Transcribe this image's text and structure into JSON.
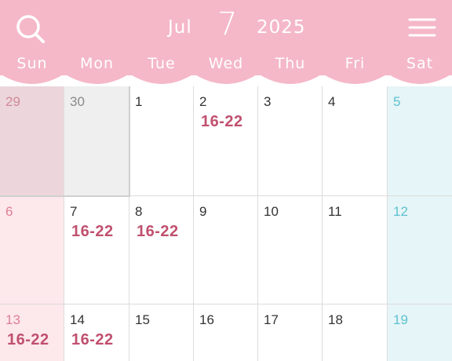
{
  "header": {
    "month_name": "Jul",
    "month_number": "7",
    "year": "2025",
    "search_icon": "search-icon",
    "menu_icon": "menu-icon",
    "text_color": "#ffffff",
    "background_color": "#f5b8c8"
  },
  "weekdays": [
    "Sun",
    "Mon",
    "Tue",
    "Wed",
    "Thu",
    "Fri",
    "Sat"
  ],
  "weeks": [
    [
      {
        "day": "29",
        "event": "",
        "prev": true
      },
      {
        "day": "30",
        "event": "",
        "prev": true
      },
      {
        "day": "1",
        "event": ""
      },
      {
        "day": "2",
        "event": "16-22"
      },
      {
        "day": "3",
        "event": ""
      },
      {
        "day": "4",
        "event": ""
      },
      {
        "day": "5",
        "event": ""
      }
    ],
    [
      {
        "day": "6",
        "event": ""
      },
      {
        "day": "7",
        "event": "16-22"
      },
      {
        "day": "8",
        "event": "16-22"
      },
      {
        "day": "9",
        "event": ""
      },
      {
        "day": "10",
        "event": ""
      },
      {
        "day": "11",
        "event": ""
      },
      {
        "day": "12",
        "event": ""
      }
    ],
    [
      {
        "day": "13",
        "event": "16-22"
      },
      {
        "day": "14",
        "event": "16-22"
      },
      {
        "day": "15",
        "event": ""
      },
      {
        "day": "16",
        "event": ""
      },
      {
        "day": "17",
        "event": ""
      },
      {
        "day": "18",
        "event": ""
      },
      {
        "day": "19",
        "event": ""
      }
    ]
  ],
  "colors": {
    "sunday_bg": "#fde8ec",
    "saturday_bg": "#e6f5f7",
    "sunday_text": "#e07f93",
    "saturday_text": "#5cc2d0",
    "event_text": "#c0506e"
  }
}
